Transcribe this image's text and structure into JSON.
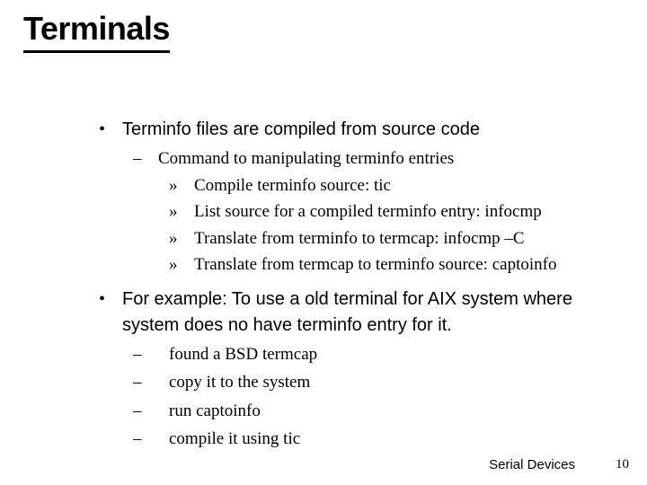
{
  "title": "Terminals",
  "bullets": {
    "l1a": "Terminfo files are compiled from source code",
    "l2a": "Command to manipulating terminfo entries",
    "l3a": "Compile terminfo source: tic",
    "l3b": "List source for a compiled terminfo entry: infocmp",
    "l3c": "Translate from terminfo to termcap: infocmp –C",
    "l3d": "Translate from termcap to terminfo source: captoinfo",
    "l1b": "For example: To use a old terminal for AIX system where system does no have terminfo entry for it.",
    "step1": "found a BSD termcap",
    "step2": "copy it to the system",
    "step3": "run captoinfo",
    "step4": "compile it using tic"
  },
  "marks": {
    "dot": "•",
    "dash": "–",
    "raquo": "»"
  },
  "footer": {
    "label": "Serial Devices",
    "page": "10"
  }
}
